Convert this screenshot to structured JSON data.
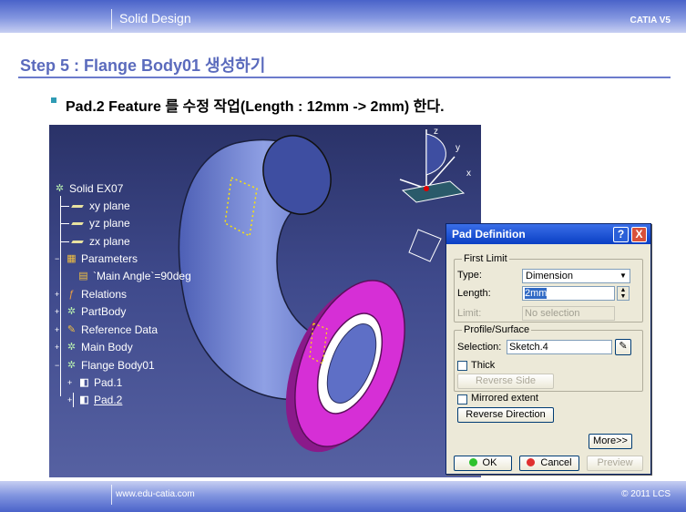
{
  "header": {
    "title": "Solid Design",
    "brand": "CATIA V5"
  },
  "step": {
    "heading": "Step 5 : Flange Body01 생성하기"
  },
  "bullet": {
    "text": "Pad.2 Feature 를 수정 작업(Length : 12mm -> 2mm) 한다."
  },
  "compass": {
    "z": "z",
    "y": "y",
    "x": "x"
  },
  "tree": {
    "root": "Solid EX07",
    "items": [
      {
        "label": "xy plane",
        "icon": "plane-icon"
      },
      {
        "label": "yz plane",
        "icon": "plane-icon"
      },
      {
        "label": "zx plane",
        "icon": "plane-icon"
      },
      {
        "label": "Parameters",
        "icon": "parameters-icon"
      },
      {
        "label": "`Main Angle`=90deg",
        "icon": "parameter-icon"
      },
      {
        "label": "Relations",
        "icon": "relations-icon"
      },
      {
        "label": "PartBody",
        "icon": "body-icon"
      },
      {
        "label": "Reference Data",
        "icon": "reference-icon"
      },
      {
        "label": "Main Body",
        "icon": "body-icon"
      },
      {
        "label": "Flange Body01",
        "icon": "body-icon"
      },
      {
        "label": "Pad.1",
        "icon": "pad-icon"
      },
      {
        "label": "Pad.2",
        "icon": "pad-icon"
      }
    ]
  },
  "dialog": {
    "title": "Pad Definition",
    "help": "?",
    "close": "X",
    "first_limit": "First Limit",
    "type_label": "Type:",
    "type_value": "Dimension",
    "length_label": "Length:",
    "length_value": "2mm",
    "limit_label": "Limit:",
    "limit_value": "No selection",
    "profile_group": "Profile/Surface",
    "selection_label": "Selection:",
    "selection_value": "Sketch.4",
    "thick_label": "Thick",
    "reverse_side": "Reverse Side",
    "mirrored_label": "Mirrored extent",
    "reverse_direction": "Reverse Direction",
    "more": "More>>",
    "ok": "OK",
    "cancel": "Cancel",
    "preview": "Preview"
  },
  "footer": {
    "url": "www.edu-catia.com",
    "copyright": "© 2011 LCS"
  },
  "colors": {
    "accent": "#5b6bbd",
    "flange": "#d62fd6",
    "pipe": "#7d8ed8",
    "background": "#3f4a8c"
  }
}
